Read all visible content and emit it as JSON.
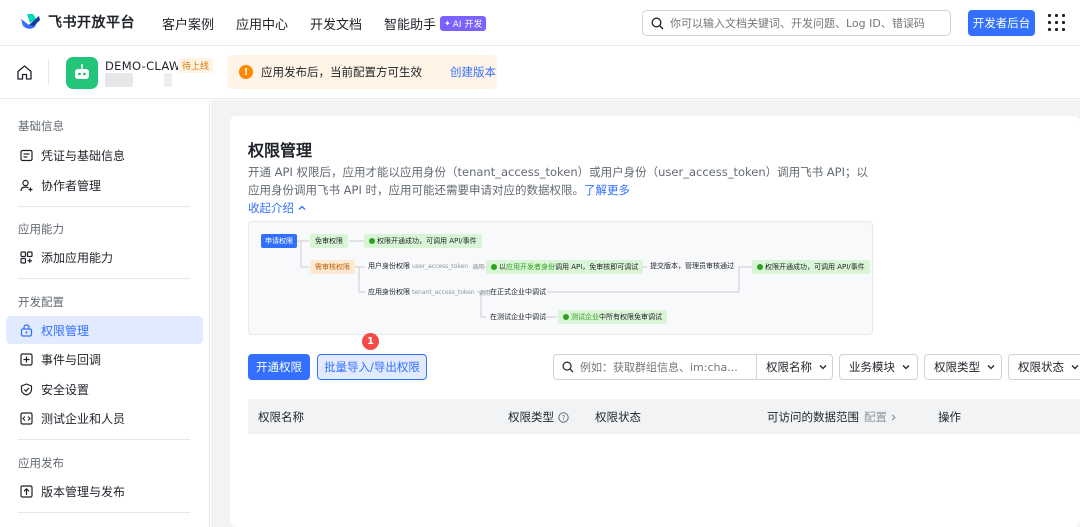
{
  "brand": {
    "name": "飞书开放平台"
  },
  "nav": {
    "links": [
      "客户案例",
      "应用中心",
      "开发文档"
    ],
    "ai_label": "智能助手",
    "ai_badge": "AI 开发",
    "search_placeholder": "你可以输入文档关键词、开发问题、Log ID、错误码",
    "dev_button": "开发者后台"
  },
  "app": {
    "name": "DEMO-CLAW",
    "status": "待上线",
    "notice_icon": "!",
    "notice_text": "应用发布后，当前配置方可生效",
    "notice_link": "创建版本",
    "avatar_color": "#24c47a"
  },
  "sidebar": {
    "sections": [
      {
        "title": "基础信息",
        "items": [
          {
            "label": "凭证与基础信息",
            "icon": "credential-icon"
          },
          {
            "label": "协作者管理",
            "icon": "user-add-icon"
          }
        ]
      },
      {
        "title": "应用能力",
        "items": [
          {
            "label": "添加应用能力",
            "icon": "apps-add-icon"
          }
        ]
      },
      {
        "title": "开发配置",
        "items": [
          {
            "label": "权限管理",
            "icon": "lock-icon",
            "active": true
          },
          {
            "label": "事件与回调",
            "icon": "event-icon"
          },
          {
            "label": "安全设置",
            "icon": "shield-icon"
          },
          {
            "label": "测试企业和人员",
            "icon": "code-icon"
          }
        ]
      },
      {
        "title": "应用发布",
        "items": [
          {
            "label": "版本管理与发布",
            "icon": "upload-icon"
          }
        ]
      }
    ]
  },
  "main": {
    "title": "权限管理",
    "desc": "开通 API 权限后，应用才能以应用身份（tenant_access_token）或用户身份（user_access_token）调用飞书 API；以应用身份调用飞书 API 时，应用可能还需要申请对应的数据权限。",
    "desc_link": "了解更多",
    "collapse": "收起介绍",
    "flow": {
      "apply": "申请权限",
      "free": "免审权限",
      "free_result": "权限开通成功，可调用 API/事件",
      "review": "需审核权限",
      "user_perm": "用户身份权限",
      "user_token": "user_access_token",
      "call": "调用",
      "dev_prefix": "以",
      "dev_hl": "应用开发者身份",
      "dev_suffix": "调用 API，免审核即可调试",
      "submit": "提交版本，管理员审核通过",
      "final": "权限开通成功，可调用 API/事件",
      "app_perm": "应用身份权限",
      "tenant_token": "tenant_access_token",
      "formal": "在正式企业中调试",
      "test": "在测试企业中调试",
      "test_hl": "测试企业",
      "test_suffix": "中所有权限免审调试"
    },
    "btn_open": "开通权限",
    "btn_batch": "批量导入/导出权限",
    "step_badge": "1",
    "filter_placeholder": "例如：获取群组信息、im:cha...",
    "filters": [
      "权限名称",
      "业务模块",
      "权限类型",
      "权限状态"
    ],
    "table": {
      "col_name": "权限名称",
      "col_type": "权限类型",
      "col_status": "权限状态",
      "col_scope": "可访问的数据范围",
      "col_scope_sub": "配置",
      "col_action": "操作"
    }
  }
}
